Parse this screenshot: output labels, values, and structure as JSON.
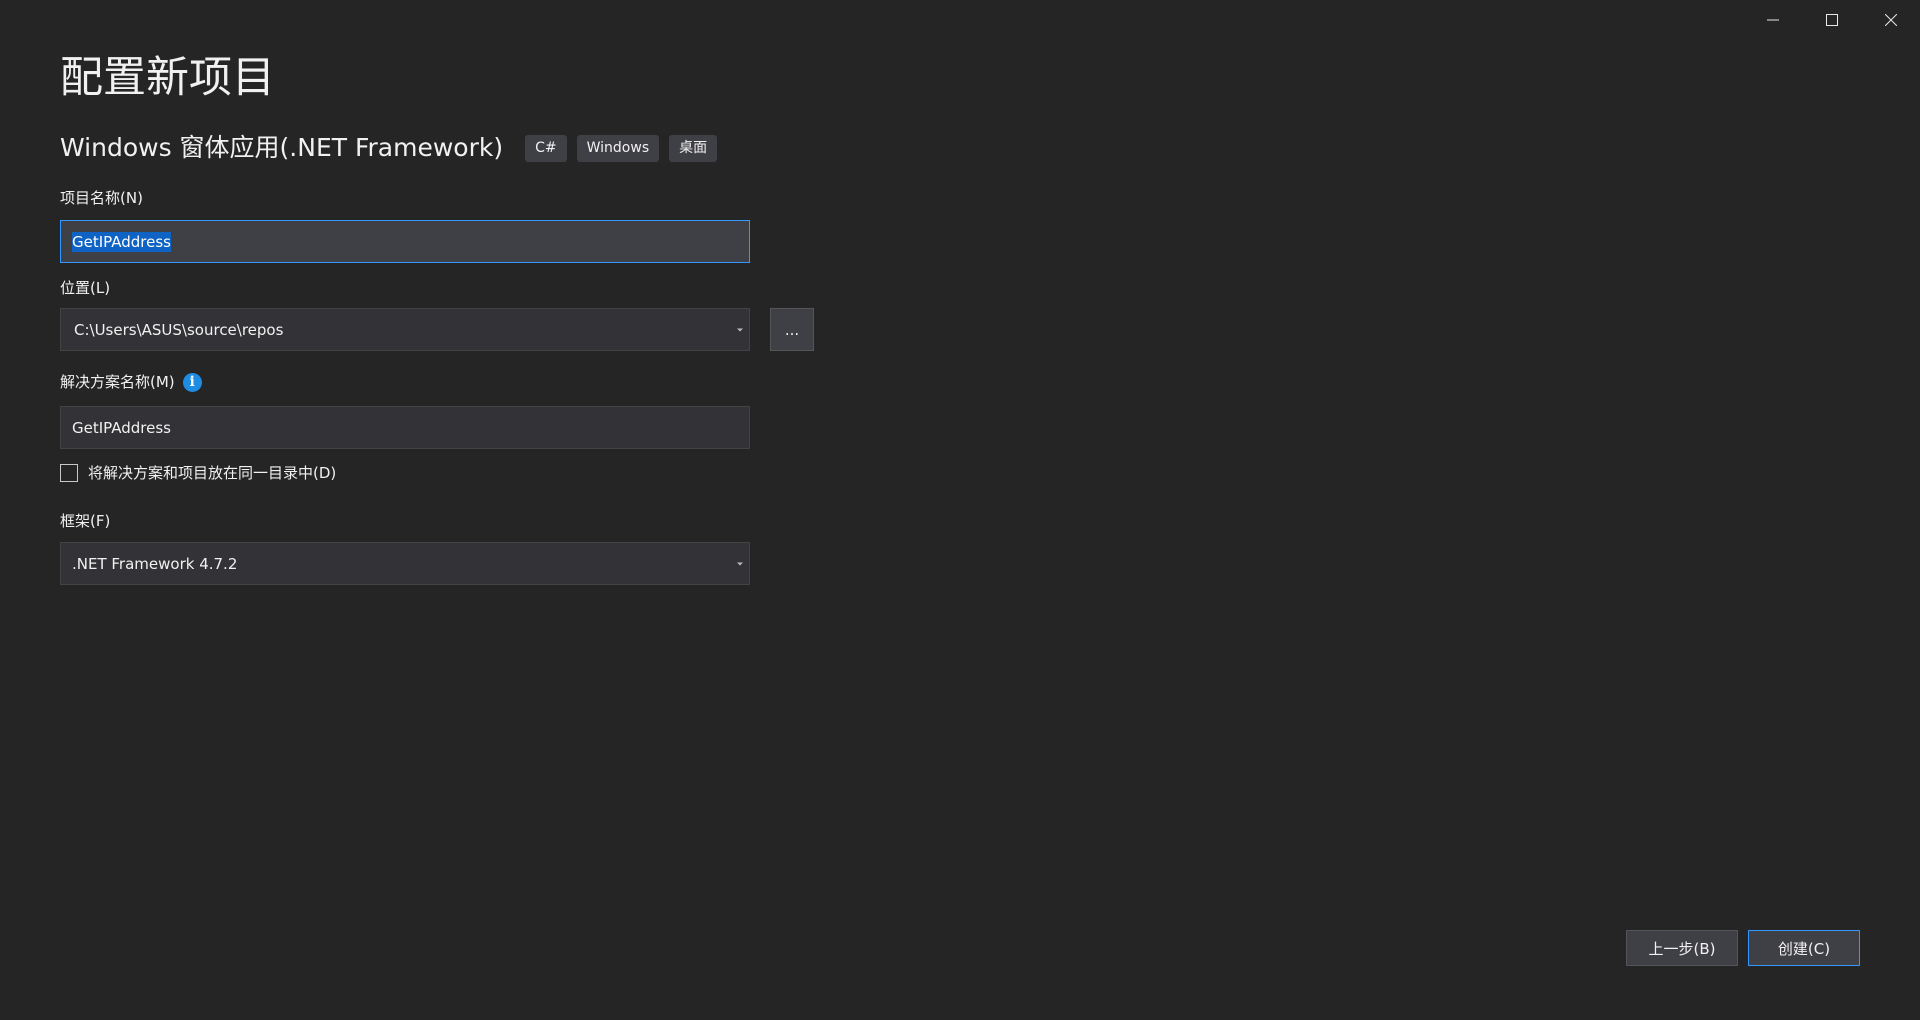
{
  "window_controls": {
    "minimize_icon": "minimize-icon",
    "maximize_icon": "maximize-icon",
    "close_icon": "close-icon"
  },
  "header": {
    "title": "配置新项目",
    "template_name": "Windows 窗体应用(.NET Framework)",
    "tags": [
      "C#",
      "Windows",
      "桌面"
    ]
  },
  "form": {
    "project_name": {
      "label": "项目名称(N)",
      "value": "GetIPAddress"
    },
    "location": {
      "label": "位置(L)",
      "value": "C:\\Users\\ASUS\\source\\repos",
      "browse_label": "..."
    },
    "solution_name": {
      "label": "解决方案名称(M)",
      "info_icon": "info-icon",
      "info_glyph": "i",
      "value": "GetIPAddress"
    },
    "same_directory": {
      "label": "将解决方案和项目放在同一目录中(D)",
      "checked": false
    },
    "framework": {
      "label": "框架(F)",
      "value": ".NET Framework 4.7.2"
    }
  },
  "footer": {
    "back_label": "上一步(B)",
    "create_label": "创建(C)"
  },
  "colors": {
    "background": "#252526",
    "field": "#333337",
    "focus_border": "#3399ff",
    "selection": "#0e63c4",
    "info": "#1e8ce3"
  }
}
